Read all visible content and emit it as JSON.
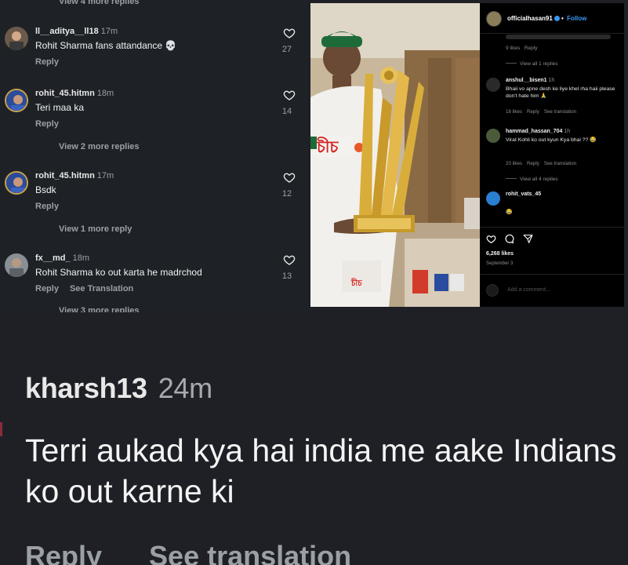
{
  "left_panel": {
    "top_more": "View 4 more replies",
    "comments": [
      {
        "user": "ll__aditya__ll18",
        "time": "17m",
        "text": "Rohit Sharma fans attandance 💀",
        "actions": [
          "Reply"
        ],
        "likes": "27"
      },
      {
        "user": "rohit_45.hitmn",
        "time": "18m",
        "text": "Teri maa ka",
        "actions": [
          "Reply"
        ],
        "likes": "14"
      },
      {
        "user": "rohit_45.hitmn",
        "time": "17m",
        "text": "Bsdk",
        "actions": [
          "Reply"
        ],
        "likes": "12"
      },
      {
        "user": "fx__md_",
        "time": "18m",
        "text": "Rohit Sharma ko out karta he madrchod",
        "actions": [
          "Reply",
          "See Translation"
        ],
        "likes": "13"
      }
    ],
    "view_more": [
      "View 2 more replies",
      "View 1 more reply",
      "View 3 more replies"
    ]
  },
  "post": {
    "account": "officialhasan91",
    "follow": "Follow",
    "reply_likes": "9 likes",
    "reply_label": "Reply",
    "view_all_1": "View all 1 replies",
    "comments": [
      {
        "user": "anshul__bisen1",
        "time": "1h",
        "text": "Bhaii vo apne desh ke liye khel rha haii please don't hate him 🙏",
        "likes": "18 likes",
        "reply": "Reply",
        "translate": "See translation"
      },
      {
        "user": "hammad_hassan_704",
        "time": "1h",
        "text": "Virat Kohli ko out kyun Kya bhai ?? 😂",
        "likes": "20 likes",
        "reply": "Reply",
        "translate": "See translation"
      },
      {
        "user": "rohit_vats_45",
        "time": "",
        "text": "😂",
        "likes": "",
        "reply": "",
        "translate": ""
      }
    ],
    "view_all_4": "View all 4 replies",
    "likes_count": "6,268 likes",
    "date": "September 3",
    "add_comment_placeholder": "Add a comment…",
    "photo_text": "চীচ"
  },
  "big_comment": {
    "user": "kharsh13",
    "time": "24m",
    "text": "Terri aukad kya hai india me aake Indians ko out karne ki",
    "reply": "Reply",
    "translate": "See translation"
  },
  "colors": {
    "panel_bg": "#1e2227",
    "post_bg": "#000000",
    "link_blue": "#3897f0",
    "bottom_bg": "#1f2026"
  },
  "icons": [
    "heart-icon",
    "comment-icon",
    "share-icon",
    "verified-icon",
    "smile-icon"
  ]
}
